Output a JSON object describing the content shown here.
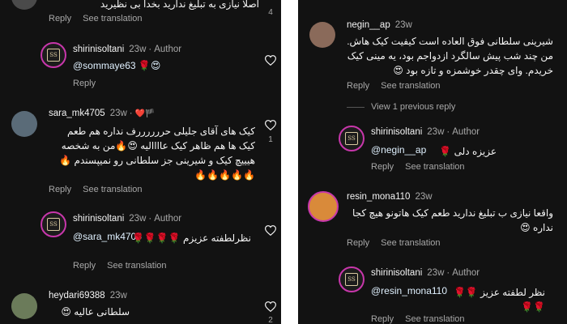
{
  "common": {
    "reply": "Reply",
    "see_translation": "See translation",
    "author_label": "Author",
    "dot": "·"
  },
  "left": {
    "top_partial": {
      "text": "اصلا نیازی به تبلیغ ندارید بخدا بی نظیرید",
      "likes": "4"
    },
    "c1": {
      "username": "shirinisoltani",
      "time": "23w",
      "mention": "@sommaye63",
      "emoji": "🌹😍"
    },
    "c2": {
      "username": "sara_mk4705",
      "time": "23w",
      "badge": "❤️🏴",
      "text": "کیک های آقای جلیلی حررررررف نداره هم طعم کیک ها هم ظاهر کیک عاااالیه 😍🔥من به شخصه هیییچ کیک و شیرینی جز سلطانی رو نمیپسندم 🔥🔥🔥🔥🔥🔥",
      "likes": "1"
    },
    "c3": {
      "username": "shirinisoltani",
      "time": "23w",
      "mention": "@sara_mk4705",
      "text": "نظرلطفته عزیزم 🌹🌹🌹🌹"
    },
    "c4": {
      "username": "heydari69388",
      "time": "23w",
      "text": "سلطانی عالیه 😍",
      "likes": "2"
    }
  },
  "right": {
    "c1": {
      "username": "negin__ap",
      "time": "23w",
      "text": "شیرینی سلطانی فوق العاده است کیفیت کیک هاش. من چند شب پیش سالگرد ازدواجم بود، یه مینی کیک خریدم. وای چقدر خوشمزه و تازه بود 😍"
    },
    "view_previous": "View 1 previous reply",
    "c2": {
      "username": "shirinisoltani",
      "time": "23w",
      "mention": "@negin__ap",
      "text": "عزیزه دلی 🌹"
    },
    "c3": {
      "username": "resin_mona110",
      "time": "23w",
      "text": "واقعا نیازی ب تبلیغ ندارید طعم کیک هاتونو هیچ کجا نداره 😍"
    },
    "c4": {
      "username": "shirinisoltani",
      "time": "23w",
      "mention": "@resin_mona110",
      "text": "نظر لطفته عزیز 🌹🌹🌹🌹"
    }
  },
  "colors": {
    "background": "#121212",
    "muted": "#a8a8a8",
    "mention": "#e0f1ff",
    "story_ring": "#c837ab"
  }
}
